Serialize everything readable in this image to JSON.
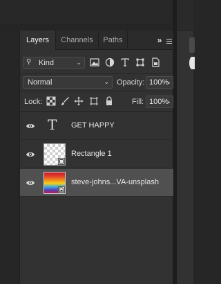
{
  "tabs": {
    "layers": "Layers",
    "channels": "Channels",
    "paths": "Paths",
    "collapse_glyph": "»"
  },
  "filter": {
    "kind_label": "Kind",
    "icons": [
      "pixel-filter-icon",
      "adjustment-filter-icon",
      "type-filter-icon",
      "shape-filter-icon",
      "smart-object-filter-icon"
    ]
  },
  "blend": {
    "mode": "Normal",
    "opacity_label": "Opacity:",
    "opacity_value": "100%"
  },
  "lock": {
    "label": "Lock:",
    "icons": [
      "lock-transparent-icon",
      "lock-paint-icon",
      "lock-position-icon",
      "lock-artboard-icon",
      "lock-all-icon"
    ],
    "fill_label": "Fill:",
    "fill_value": "100%"
  },
  "layers": [
    {
      "name": "GET HAPPY",
      "kind": "type",
      "visible": true,
      "selected": false
    },
    {
      "name": "Rectangle 1",
      "kind": "shape",
      "visible": true,
      "selected": false
    },
    {
      "name": "steve-johns...VA-unsplash",
      "kind": "smart-object",
      "visible": true,
      "selected": true
    }
  ],
  "colors": {
    "panel_bg": "#323232",
    "selected_row": "#505050",
    "text": "#e6e6e6"
  }
}
